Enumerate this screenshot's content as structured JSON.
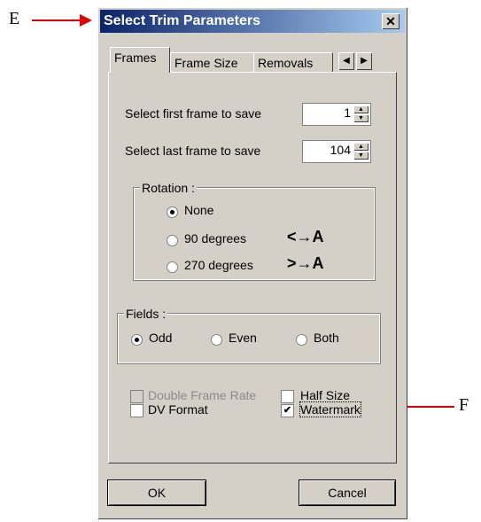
{
  "callouts": {
    "e": "E",
    "f": "F"
  },
  "dialog": {
    "title": "Select Trim Parameters",
    "close_glyph": "✕",
    "tabs": [
      "Frames",
      "Frame Size",
      "Removals"
    ],
    "tab_scroll": {
      "left": "◀",
      "right": "▶"
    },
    "first_frame": {
      "label": "Select first frame to save",
      "value": "1"
    },
    "last_frame": {
      "label": "Select last frame to save",
      "value": "104"
    },
    "rotation": {
      "legend": "Rotation :",
      "options": [
        {
          "label": "None",
          "checked": true,
          "glyph": ""
        },
        {
          "label": "90 degrees",
          "checked": false,
          "glyph": "<→A"
        },
        {
          "label": "270 degrees",
          "checked": false,
          "glyph": ">→A"
        }
      ]
    },
    "fields": {
      "legend": "Fields :",
      "options": [
        {
          "label": "Odd",
          "checked": true
        },
        {
          "label": "Even",
          "checked": false
        },
        {
          "label": "Both",
          "checked": false
        }
      ]
    },
    "checkboxes": {
      "double_frame_rate": {
        "label": "Double Frame Rate",
        "checked": false,
        "disabled": true
      },
      "half_size": {
        "label": "Half Size",
        "checked": false
      },
      "dv_format": {
        "label": "DV Format",
        "checked": false
      },
      "watermark": {
        "label": "Watermark",
        "checked": true
      }
    },
    "buttons": {
      "ok": "OK",
      "cancel": "Cancel"
    }
  },
  "colors": {
    "arrow": "#e00000",
    "titlebar_start": "#0a246a",
    "titlebar_end": "#a6caf0",
    "dialog_face": "#d4d0c8"
  }
}
